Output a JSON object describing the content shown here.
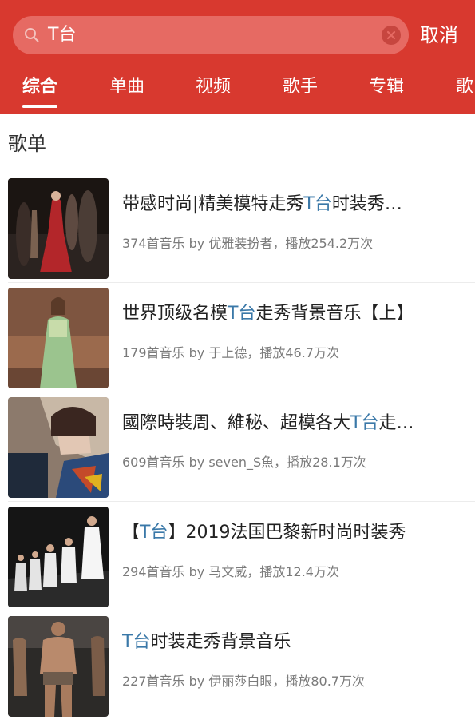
{
  "search": {
    "query": "T台",
    "cancel_label": "取消"
  },
  "tabs": [
    {
      "label": "综合",
      "active": true
    },
    {
      "label": "单曲",
      "active": false
    },
    {
      "label": "视频",
      "active": false
    },
    {
      "label": "歌手",
      "active": false
    },
    {
      "label": "专辑",
      "active": false
    },
    {
      "label": "歌",
      "active": false
    }
  ],
  "section": {
    "title": "歌单"
  },
  "playlists": [
    {
      "title_before": "带感时尚|精美模特走秀",
      "title_highlight": "T台",
      "title_after": "时装秀…",
      "meta": "374首音乐   by 优雅装扮者，播放254.2万次"
    },
    {
      "title_before": "世界顶级名模",
      "title_highlight": "T台",
      "title_after": "走秀背景音乐【上】",
      "meta": "179首音乐   by 于上德，播放46.7万次"
    },
    {
      "title_before": "國際時裝周、維秘、超模各大",
      "title_highlight": "T台",
      "title_after": "走…",
      "meta": "609首音乐   by seven_S魚，播放28.1万次"
    },
    {
      "title_before": "【",
      "title_highlight": "T台",
      "title_after": "】2019法国巴黎新时尚时装秀",
      "meta": "294首音乐   by 马文威，播放12.4万次"
    },
    {
      "title_before": "",
      "title_highlight": "T台",
      "title_after": "时装走秀背景音乐",
      "meta": "227首音乐   by 伊丽莎白眼，播放80.7万次"
    }
  ],
  "colors": {
    "header": "#d8392f",
    "highlight": "#3a78a8"
  }
}
